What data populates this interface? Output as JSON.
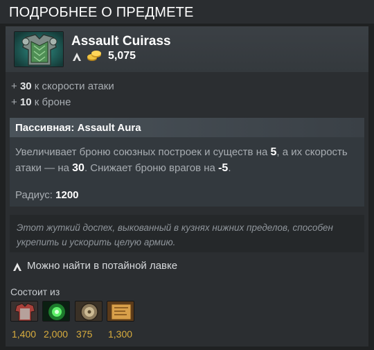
{
  "panel": {
    "title": "ПОДРОБНЕЕ О ПРЕДМЕТЕ"
  },
  "item": {
    "name": "Assault Cuirass",
    "cost": "5,075",
    "image_icon": "armor-cuirass-icon"
  },
  "attributes": [
    {
      "prefix": "+ ",
      "value": "30",
      "text": " к скорости атаки"
    },
    {
      "prefix": "+ ",
      "value": "10",
      "text": " к броне"
    }
  ],
  "ability": {
    "title": "Пассивная: Assault Aura",
    "desc_part1": "Увеличивает броню союзных построек и существ на ",
    "value1": "5",
    "desc_part2": ", а их скорость атаки — на ",
    "value2": "30",
    "desc_part3": ". Снижает броню врагов на ",
    "value3": "-5",
    "desc_part4": ".",
    "radius_label": "Радиус: ",
    "radius_value": "1200"
  },
  "lore": "Этот жуткий доспех, выкованный в кузнях нижних пределов, способен укрепить и ускорить целую армию.",
  "secret_shop": "Можно найти в потайной лавке",
  "components_label": "Состоит из",
  "components": [
    {
      "icon": "chainmail-icon",
      "price": "1,400"
    },
    {
      "icon": "hyperstone-icon",
      "price": "2,000"
    },
    {
      "icon": "buckler-icon",
      "price": "375"
    },
    {
      "icon": "platemail-recipe-icon",
      "price": "1,300"
    }
  ],
  "colors": {
    "gold": "#d9ad3e",
    "background": "#1f2122",
    "header": "#3b4045"
  }
}
